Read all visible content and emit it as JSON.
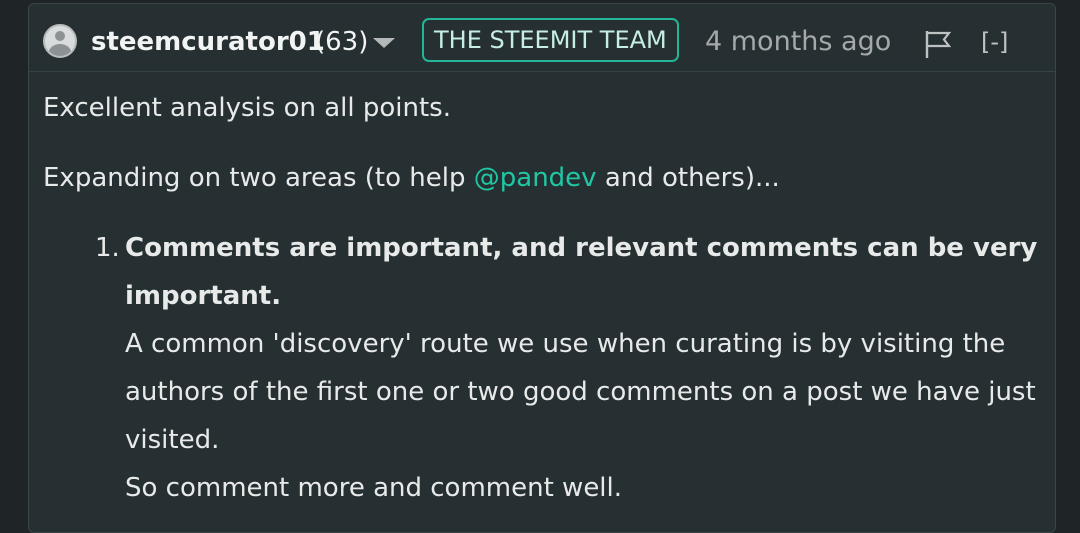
{
  "comment": {
    "author": "steemcurator01",
    "reputation": "(63)",
    "badge": "THE STEEMIT TEAM",
    "time": "4 months ago",
    "collapse_label": "[-]",
    "paragraphs": {
      "p1": "Excellent analysis on all points.",
      "p2_before": "Expanding on two areas (to help ",
      "p2_mention": "@pandev",
      "p2_after": " and others)..."
    },
    "list": {
      "item1": {
        "number": "1.",
        "heading": "Comments are important, and relevant comments can be very important.",
        "lines": [
          "A common 'discovery' route we use when curating is by visiting the authors of the first one or two good comments on a post we have just visited.",
          "So comment more and comment well."
        ]
      }
    }
  },
  "colors": {
    "background": "#263032",
    "accent": "#21c7a4",
    "text": "#e8eaea",
    "muted": "#a5a9aa"
  },
  "icons": [
    "avatar-placeholder-icon",
    "caret-down-icon",
    "flag-icon"
  ]
}
